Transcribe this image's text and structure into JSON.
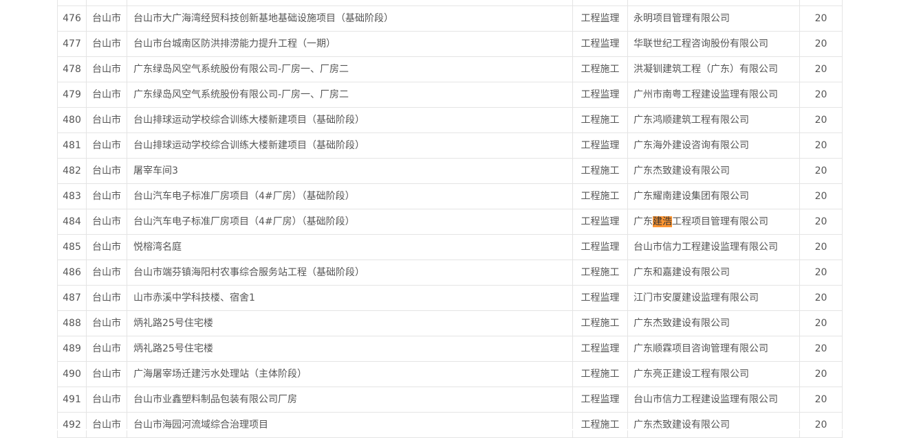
{
  "table": {
    "rows": [
      {
        "num": "",
        "city": "",
        "project": "",
        "type": "",
        "company": "",
        "score": ""
      },
      {
        "num": "476",
        "city": "台山市",
        "project": "台山市大广海湾经贸科技创新基地基础设施项目（基础阶段）",
        "type": "工程监理",
        "company": "永明项目管理有限公司",
        "score": "20"
      },
      {
        "num": "477",
        "city": "台山市",
        "project": "台山市台城南区防洪排涝能力提升工程（一期）",
        "type": "工程监理",
        "company": "华联世纪工程咨询股份有限公司",
        "score": "20"
      },
      {
        "num": "478",
        "city": "台山市",
        "project": "广东绿岛风空气系统股份有限公司-厂房一、厂房二",
        "type": "工程施工",
        "company": "洪凝钏建筑工程（广东）有限公司",
        "score": "20"
      },
      {
        "num": "479",
        "city": "台山市",
        "project": "广东绿岛风空气系统股份有限公司-厂房一、厂房二",
        "type": "工程监理",
        "company": "广州市南粤工程建设监理有限公司",
        "score": "20"
      },
      {
        "num": "480",
        "city": "台山市",
        "project": "台山排球运动学校综合训练大楼新建项目（基础阶段）",
        "type": "工程施工",
        "company": "广东鸿顺建筑工程有限公司",
        "score": "20"
      },
      {
        "num": "481",
        "city": "台山市",
        "project": "台山排球运动学校综合训练大楼新建项目（基础阶段）",
        "type": "工程监理",
        "company": "广东海外建设咨询有限公司",
        "score": "20"
      },
      {
        "num": "482",
        "city": "台山市",
        "project": "屠宰车间3",
        "type": "工程施工",
        "company": "广东杰致建设有限公司",
        "score": "20"
      },
      {
        "num": "483",
        "city": "台山市",
        "project": "台山汽车电子标准厂房项目（4#厂房）（基础阶段）",
        "type": "工程施工",
        "company": "广东耀南建设集团有限公司",
        "score": "20"
      },
      {
        "num": "484",
        "city": "台山市",
        "project": "台山汽车电子标准厂房项目（4#厂房）（基础阶段）",
        "type": "工程监理",
        "company_prefix": "广东",
        "company_highlight": "建浩",
        "company_suffix": "工程项目管理有限公司",
        "score": "20"
      },
      {
        "num": "485",
        "city": "台山市",
        "project": "悦榕湾名庭",
        "type": "工程监理",
        "company": "台山市信力工程建设监理有限公司",
        "score": "20"
      },
      {
        "num": "486",
        "city": "台山市",
        "project": "台山市端芬镇海阳村农事综合服务站工程（基础阶段）",
        "type": "工程施工",
        "company": "广东和嘉建设有限公司",
        "score": "20"
      },
      {
        "num": "487",
        "city": "台山市",
        "project": "山市赤溪中学科技楼、宿舍1",
        "type": "工程监理",
        "company": "江门市安厦建设监理有限公司",
        "score": "20"
      },
      {
        "num": "488",
        "city": "台山市",
        "project": "炳礼路25号住宅楼",
        "type": "工程施工",
        "company": "广东杰致建设有限公司",
        "score": "20"
      },
      {
        "num": "489",
        "city": "台山市",
        "project": "炳礼路25号住宅楼",
        "type": "工程监理",
        "company": "广东顺霖项目咨询管理有限公司",
        "score": "20"
      },
      {
        "num": "490",
        "city": "台山市",
        "project": "广海屠宰场迁建污水处理站（主体阶段）",
        "type": "工程施工",
        "company": "广东亮正建设工程有限公司",
        "score": "20"
      },
      {
        "num": "491",
        "city": "台山市",
        "project": "台山市业鑫塑料制品包装有限公司厂房",
        "type": "工程监理",
        "company": "台山市信力工程建设监理有限公司",
        "score": "20"
      },
      {
        "num": "492",
        "city": "台山市",
        "project": "台山市海园河流域综合治理项目",
        "type": "工程施工",
        "company": "广东杰致建设有限公司",
        "score": "20"
      }
    ]
  },
  "colors": {
    "border": "#e4e4e4",
    "text": "#555555",
    "search_highlight": "#ff9632"
  }
}
